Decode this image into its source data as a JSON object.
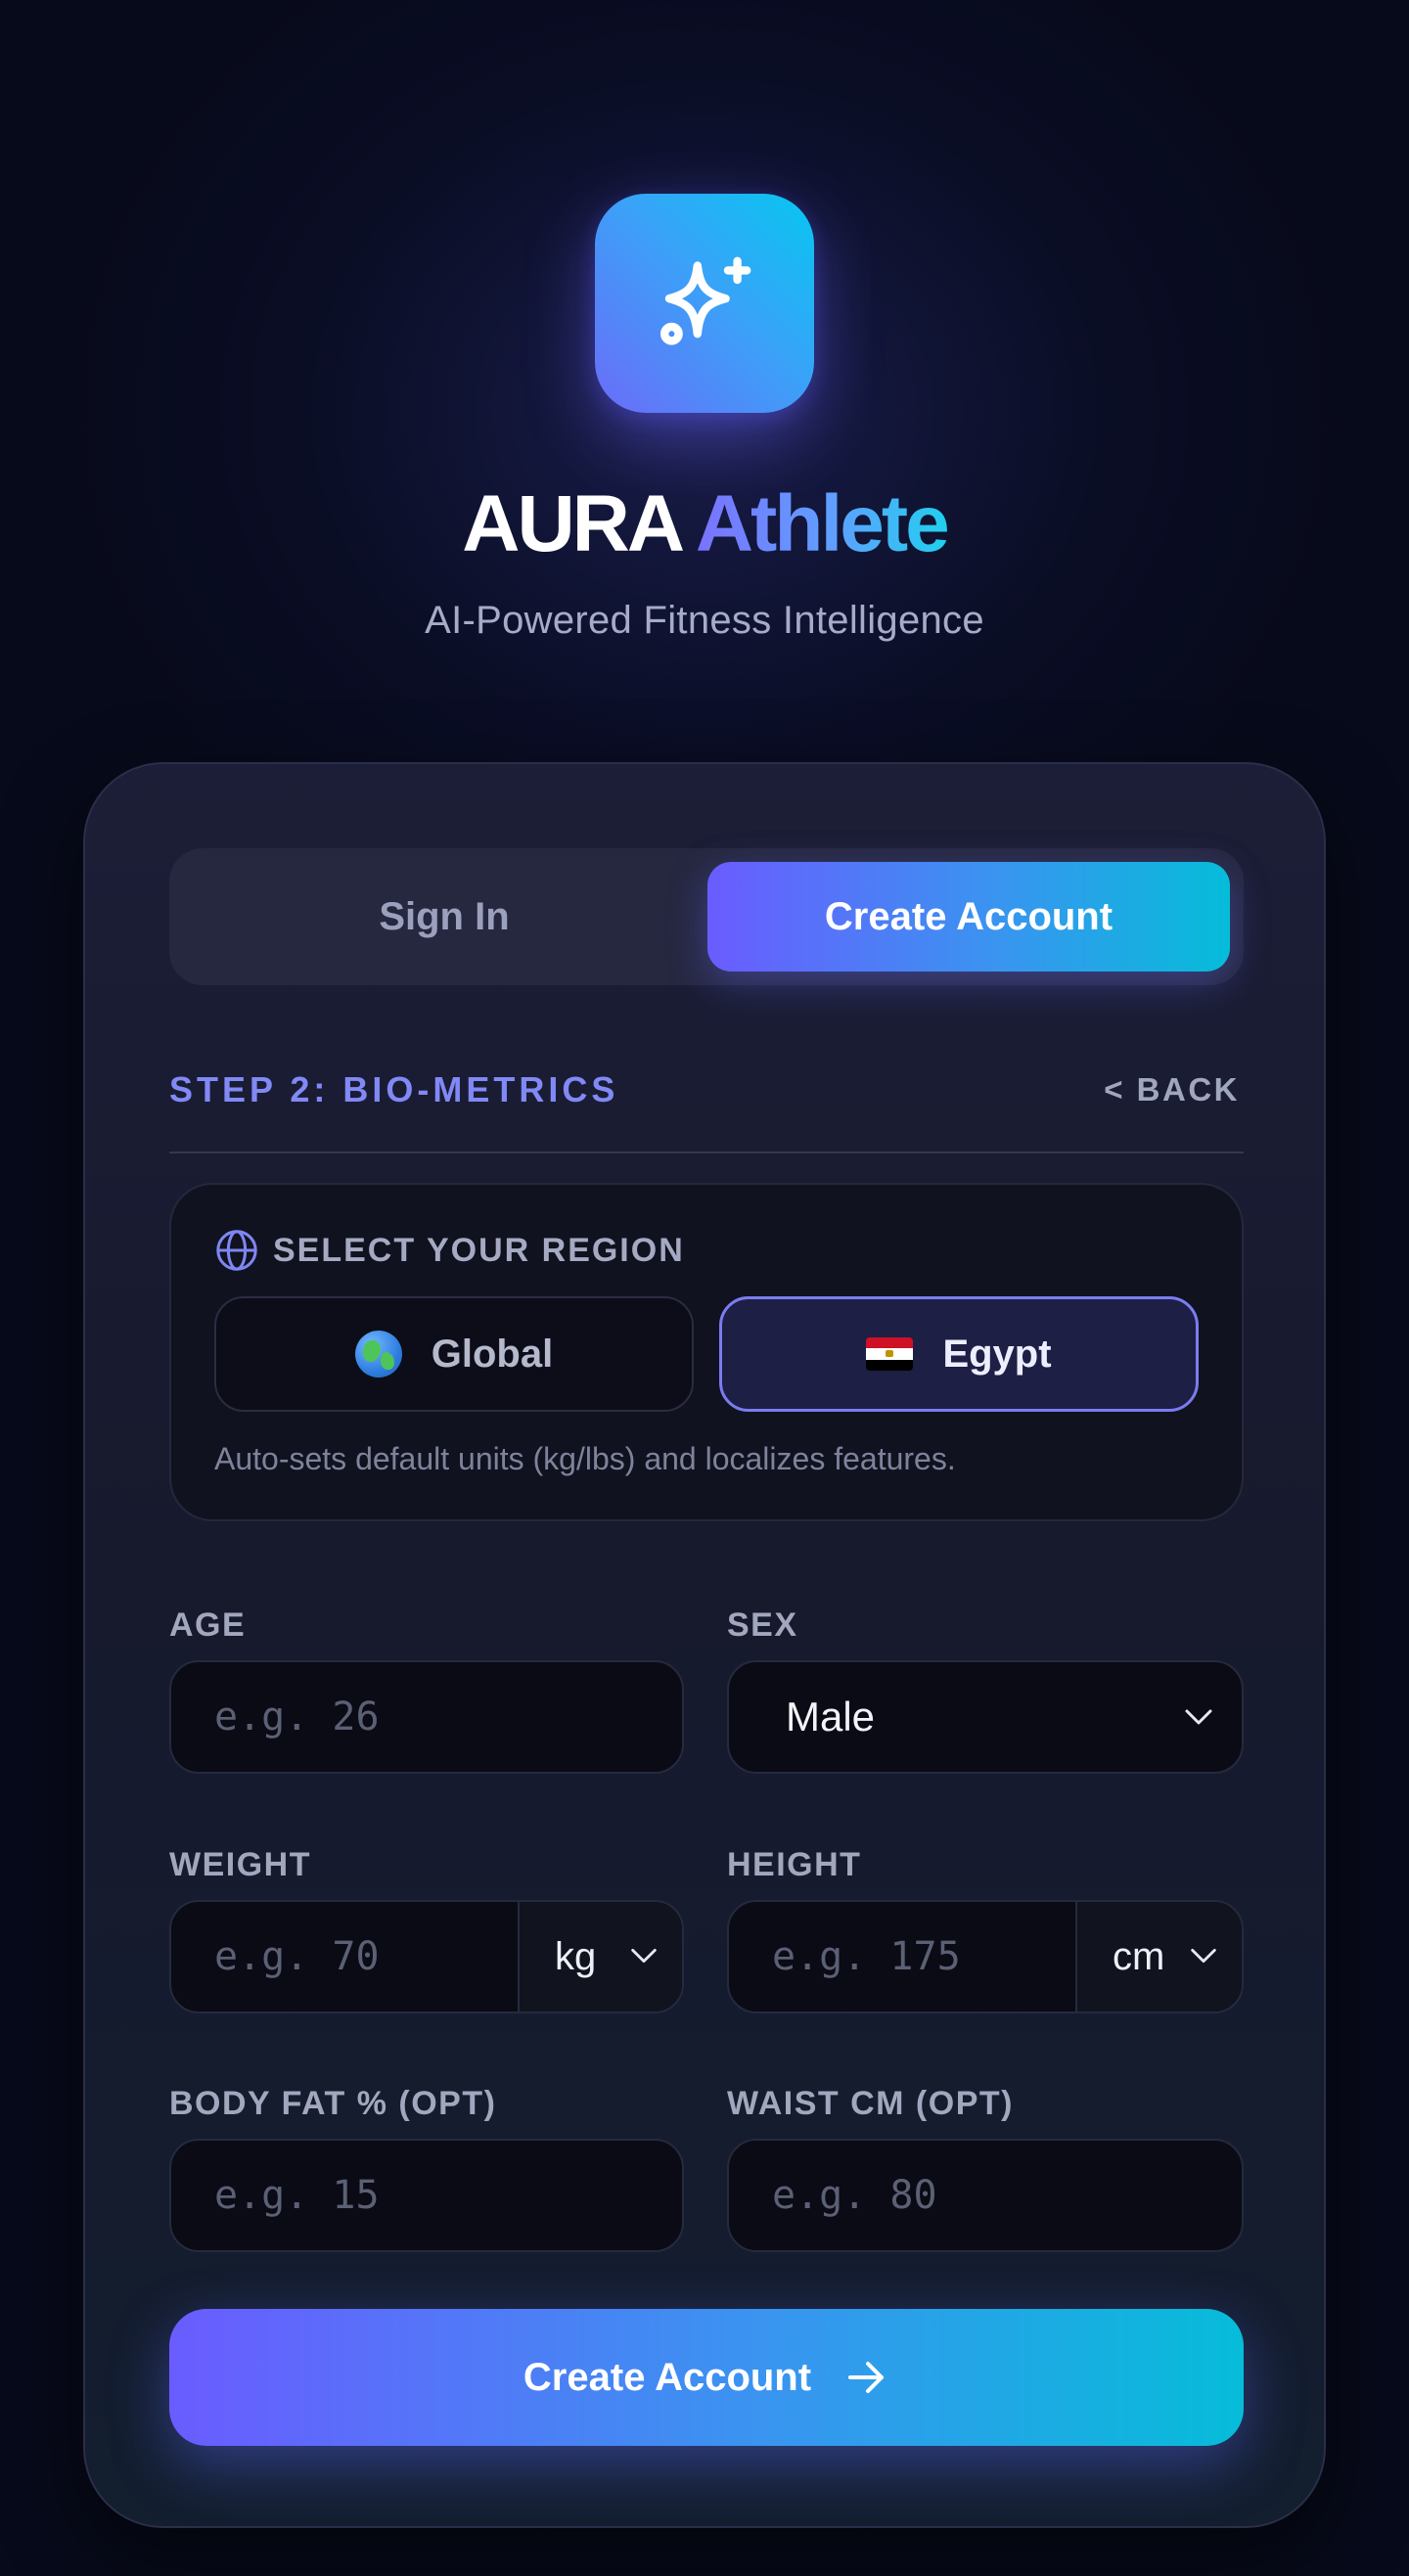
{
  "header": {
    "logo_icon": "sparkles-icon",
    "brand_primary": "AURA",
    "brand_secondary": "Athlete",
    "tagline": "AI-Powered Fitness Intelligence"
  },
  "auth_tabs": [
    {
      "label": "Sign In",
      "active": false
    },
    {
      "label": "Create Account",
      "active": true
    }
  ],
  "step": {
    "title": "STEP 2: BIO-METRICS",
    "back_label": "< BACK"
  },
  "region": {
    "icon": "globe-icon",
    "title": "SELECT YOUR REGION",
    "options": [
      {
        "label": "Global",
        "icon": "globe-emoji",
        "selected": false
      },
      {
        "label": "Egypt",
        "icon": "egypt-flag",
        "selected": true
      }
    ],
    "note": "Auto-sets default units (kg/lbs) and localizes features."
  },
  "form": {
    "age": {
      "label": "AGE",
      "placeholder": "e.g. 26"
    },
    "sex": {
      "label": "SEX",
      "value": "Male"
    },
    "weight": {
      "label": "WEIGHT",
      "placeholder": "e.g. 70",
      "unit": "kg"
    },
    "height": {
      "label": "HEIGHT",
      "placeholder": "e.g. 175",
      "unit": "cm"
    },
    "body_fat": {
      "label": "BODY FAT % (OPT)",
      "placeholder": "e.g. 15"
    },
    "waist": {
      "label": "WAIST CM (OPT)",
      "placeholder": "e.g. 80"
    }
  },
  "submit": {
    "label": "Create Account",
    "icon": "arrow-right-icon"
  },
  "colors": {
    "accent_start": "#6a5cff",
    "accent_end": "#06bcd9",
    "step_title": "#8189f6",
    "background": "#070a1a"
  }
}
